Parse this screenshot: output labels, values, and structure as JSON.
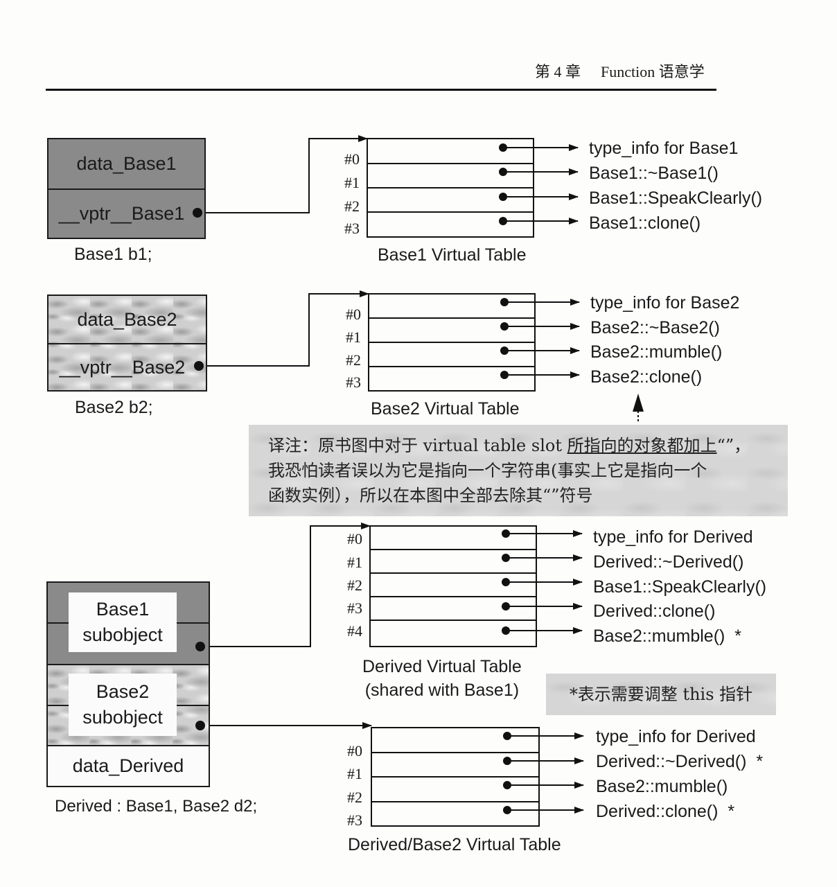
{
  "header": {
    "chapter": "第 4 章",
    "title": "Function 语意学"
  },
  "objects": {
    "b1": {
      "cells": [
        "data_Base1",
        "__vptr__Base1"
      ],
      "caption": "Base1  b1;"
    },
    "b2": {
      "cells": [
        "data_Base2",
        "__vptr__Base2"
      ],
      "caption": "Base2  b2;"
    },
    "d2": {
      "base1_sub": [
        "Base1",
        "subobject"
      ],
      "base2_sub": [
        "Base2",
        "subobject"
      ],
      "data": "data_Derived",
      "caption": "Derived : Base1, Base2 d2;"
    }
  },
  "vtables": [
    {
      "title": "Base1 Virtual Table",
      "slots": [
        "#0",
        "#1",
        "#2",
        "#3"
      ],
      "entries": [
        "type_info for Base1",
        "Base1::~Base1()",
        "Base1::SpeakClearly()",
        "Base1::clone()"
      ]
    },
    {
      "title": "Base2 Virtual Table",
      "slots": [
        "#0",
        "#1",
        "#2",
        "#3"
      ],
      "entries": [
        "type_info for Base2",
        "Base2::~Base2()",
        "Base2::mumble()",
        "Base2::clone()"
      ]
    },
    {
      "title_lines": [
        "Derived Virtual Table",
        "(shared with Base1)"
      ],
      "slots": [
        "#0",
        "#1",
        "#2",
        "#3",
        "#4"
      ],
      "entries": [
        "type_info for Derived",
        "Derived::~Derived()",
        "Base1::SpeakClearly()",
        "Derived::clone()",
        "Base2::mumble()  *"
      ]
    },
    {
      "title": "Derived/Base2 Virtual Table",
      "slots": [
        "#0",
        "#1",
        "#2",
        "#3"
      ],
      "entries": [
        "type_info for Derived",
        "Derived::~Derived()  *",
        "Base2::mumble()",
        "Derived::clone()  *"
      ]
    }
  ],
  "translator_note": {
    "line1_a": "译注：原书图中对于 virtual table slot ",
    "line1_u": "所指向的对象都加上",
    "line1_b": "“”，",
    "line2": "我恐怕读者误以为它是指向一个字符串(事实上它是指向一个",
    "line3": "函数实例），所以在本图中全部去除其“”符号"
  },
  "star_note": "*表示需要调整 this 指针"
}
